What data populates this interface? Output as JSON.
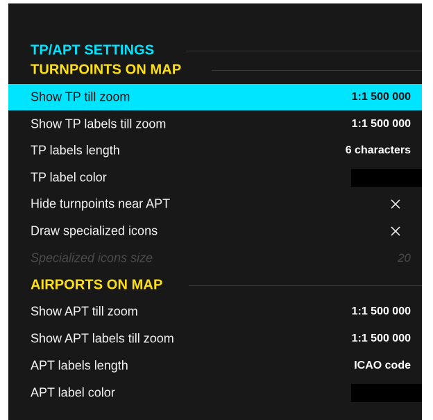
{
  "colors": {
    "cyan_heading": "#00e5ff",
    "yellow_heading": "#ffe014",
    "selected_row": "#00e5ff",
    "background": "#181818",
    "swatch": "#000000"
  },
  "header": {
    "title": "TP/APT SETTINGS"
  },
  "turnpoints": {
    "title": "TURNPOINTS ON MAP",
    "show_tp_zoom": {
      "label": "Show TP till zoom",
      "value": "1:1 500 000"
    },
    "show_tp_labels_zoom": {
      "label": "Show TP labels till zoom",
      "value": "1:1 500 000"
    },
    "tp_labels_length": {
      "label": "TP labels length",
      "value": "6 characters"
    },
    "tp_label_color": {
      "label": "TP label color",
      "swatch": "#000000"
    },
    "hide_near_apt": {
      "label": "Hide turnpoints near APT",
      "checked": true,
      "icon": "x-mark-icon"
    },
    "draw_specialized": {
      "label": "Draw specialized icons",
      "checked": true,
      "icon": "x-mark-icon"
    },
    "specialized_size": {
      "label": "Specialized icons size",
      "value": "20"
    }
  },
  "airports": {
    "title": "AIRPORTS ON MAP",
    "show_apt_zoom": {
      "label": "Show APT till zoom",
      "value": "1:1 500 000"
    },
    "show_apt_labels_zoom": {
      "label": "Show APT labels till zoom",
      "value": "1:1 500 000"
    },
    "apt_labels_length": {
      "label": "APT labels length",
      "value": "ICAO code"
    },
    "apt_label_color": {
      "label": "APT label color",
      "swatch": "#000000"
    }
  }
}
